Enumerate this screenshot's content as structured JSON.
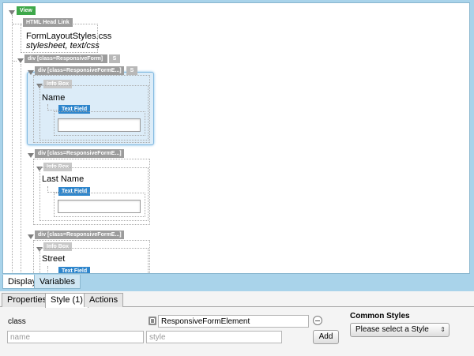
{
  "tree": {
    "root_tag": "View",
    "head_link": {
      "tag": "HTML Head Link",
      "href": "FormLayoutStyles.css",
      "meta": "stylesheet, text/css"
    },
    "form_div": {
      "tag": "div [class=ResponsiveForm]",
      "badge": "S"
    },
    "elements": [
      {
        "tag": "div [class=ResponsiveFormE...]",
        "badge": "S",
        "info_tag": "Info Box",
        "label": "Name",
        "field_tag": "Text Field"
      },
      {
        "tag": "div [class=ResponsiveFormE...]",
        "badge": "",
        "info_tag": "Info Box",
        "label": "Last Name",
        "field_tag": "Text Field"
      },
      {
        "tag": "div [class=ResponsiveFormE...]",
        "badge": "",
        "info_tag": "Info Box",
        "label": "Street",
        "field_tag": "Text Field"
      }
    ]
  },
  "view_tabs": {
    "display": "Display",
    "variables": "Variables"
  },
  "panel": {
    "tabs": [
      "Properties",
      "Style (1)",
      "Actions"
    ],
    "class_label": "class",
    "class_value": "ResponsiveFormElement",
    "binding_icon": "binding-icon",
    "name_placeholder": "name",
    "style_placeholder": "style",
    "add_label": "Add",
    "common_styles_title": "Common Styles",
    "common_styles_value": "Please select a Style"
  }
}
